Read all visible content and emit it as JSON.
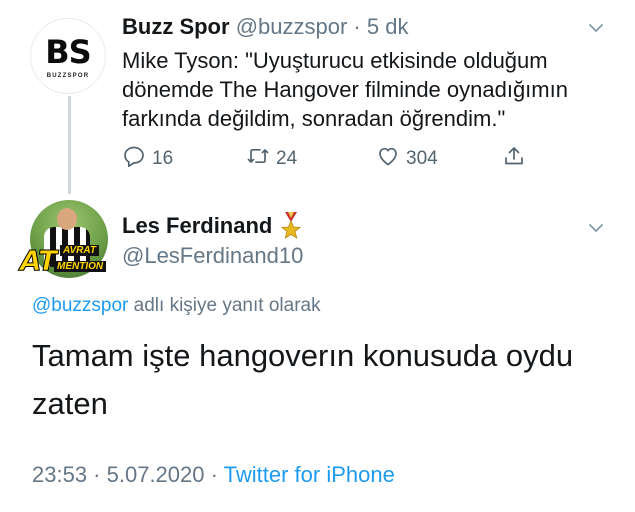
{
  "tweet1": {
    "avatar_logo": "BS",
    "avatar_logo_sub": "BUZZSPOR",
    "name": "Buzz Spor",
    "handle": "@buzzspor",
    "separator": " · ",
    "time": "5 dk",
    "text": "Mike Tyson: \"Uyuşturucu etkisinde olduğum dönemde The Hangover filminde oynadığımın farkında değildim, sonradan öğrendim.\"",
    "replies": "16",
    "retweets": "24",
    "likes": "304"
  },
  "tweet2": {
    "avatar_badge_big": "AT",
    "avatar_badge_top": "AVRAT",
    "avatar_badge_bottom": "MENTION",
    "name": "Les Ferdinand",
    "handle": "@LesFerdinand10",
    "reply_mention": "@buzzspor",
    "reply_suffix": " adlı kişiye yanıt olarak",
    "text": "Tamam işte hangoverın konusuda oydu zaten",
    "time": "23:53",
    "date": "5.07.2020",
    "meta_sep": " · ",
    "source": "Twitter for iPhone"
  },
  "colors": {
    "accent": "#1d9bf0",
    "muted": "#657786",
    "thread_line": "#cfd9de"
  },
  "icons": [
    "chevron-down-icon",
    "reply-icon",
    "retweet-icon",
    "like-icon",
    "share-icon",
    "medal-icon"
  ]
}
